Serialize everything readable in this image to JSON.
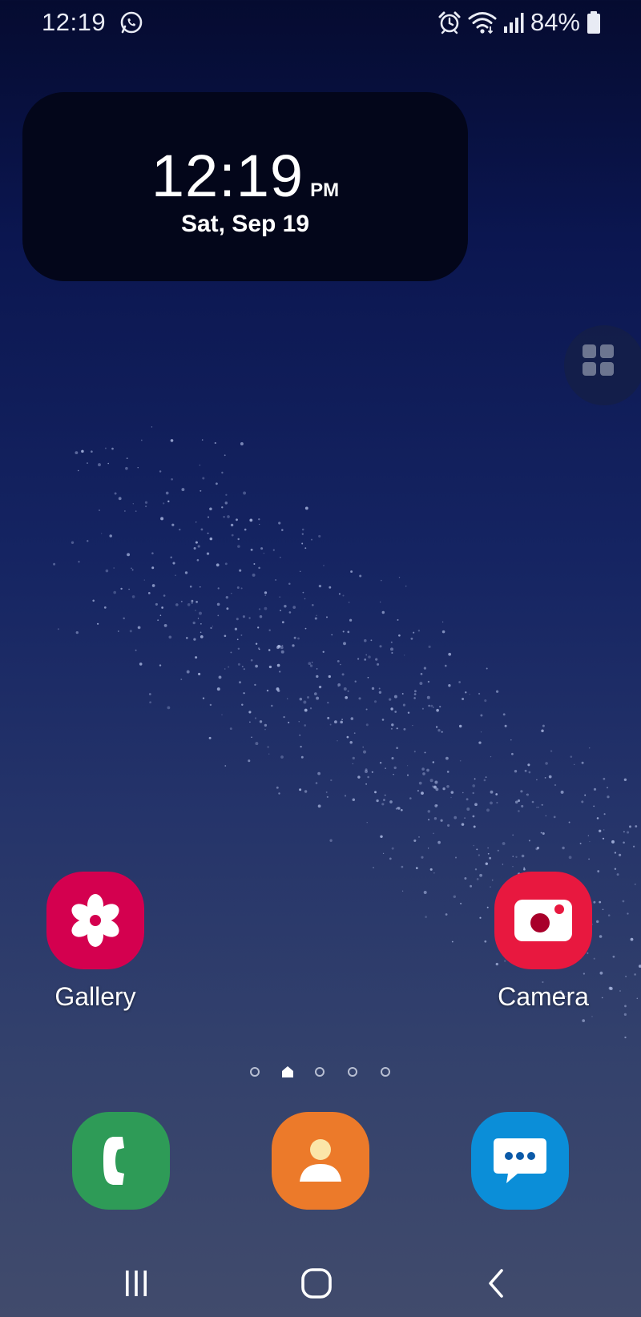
{
  "status_bar": {
    "time": "12:19",
    "battery_percent": "84%",
    "icons": [
      "whatsapp-icon",
      "alarm-icon",
      "wifi-icon",
      "signal-icon",
      "battery-icon"
    ]
  },
  "clock_widget": {
    "time": "12:19",
    "ampm": "PM",
    "date": "Sat, Sep 19"
  },
  "home_apps": [
    {
      "label": "Gallery",
      "icon": "gallery-flower-icon",
      "color": "#d4004f"
    },
    {
      "label": "Camera",
      "icon": "camera-icon",
      "color": "#e8183f"
    }
  ],
  "page_indicator": {
    "pages": 5,
    "current": 2,
    "home_page": 2
  },
  "dock": [
    {
      "name": "Phone",
      "icon": "phone-icon",
      "color": "#2e9b57"
    },
    {
      "name": "Contacts",
      "icon": "contacts-icon",
      "color": "#ec7a2a"
    },
    {
      "name": "Messages",
      "icon": "messages-icon",
      "color": "#0b8ed8"
    }
  ],
  "nav_bar": {
    "buttons": [
      "recents-icon",
      "home-icon",
      "back-icon"
    ]
  },
  "colors": {
    "widget_bg": "#03061a",
    "wallpaper_top": "#050b30",
    "wallpaper_bottom": "#414b6c"
  }
}
